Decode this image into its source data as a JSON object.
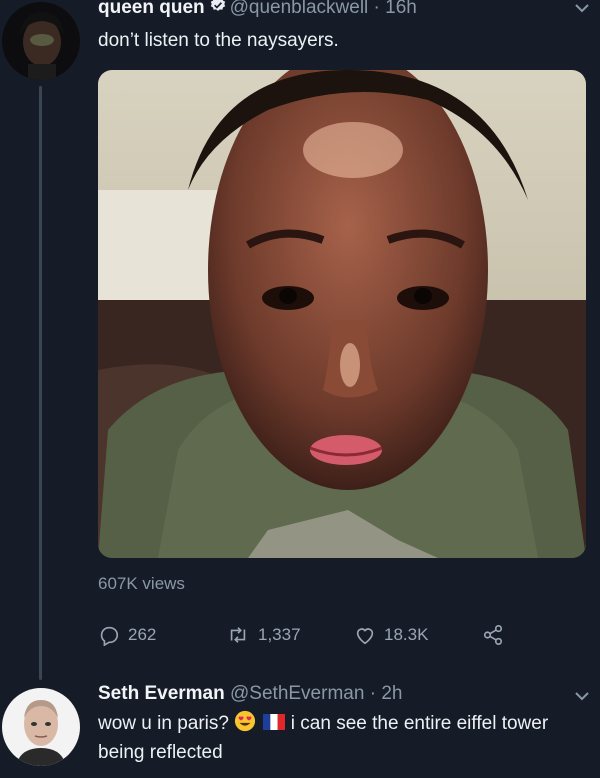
{
  "tweet": {
    "display_name": "queen quen",
    "handle": "@quenblackwell",
    "separator": "·",
    "time": "16h",
    "text": "don’t listen to the naysayers.",
    "views": "607K views",
    "replies": "262",
    "retweets": "1,337",
    "likes": "18.3K"
  },
  "reply": {
    "display_name": "Seth Everman",
    "handle": "@SethEverman",
    "separator": "·",
    "time": "2h",
    "text_before": "wow u in paris?",
    "text_after": "i can see the entire eiffel tower being reflected",
    "emojis": [
      "heart-eyes-emoji",
      "france-flag-emoji"
    ]
  },
  "colors": {
    "background": "#151c28",
    "muted": "#8a97a4",
    "verified": "#e9edf1"
  }
}
